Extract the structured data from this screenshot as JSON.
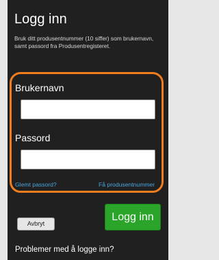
{
  "header": {
    "title": "Logg inn",
    "description": "Bruk ditt produsentnummer (10 siffer) som brukernavn, samt passord fra Produsentregisteret."
  },
  "form": {
    "username_label": "Brukernavn",
    "username_value": "",
    "password_label": "Passord",
    "password_value": "",
    "forgot_password_link": "Glemt passord?",
    "get_producer_number_link": "Få produsentnummer"
  },
  "actions": {
    "cancel_label": "Avbryt",
    "login_label": "Logg inn"
  },
  "footer": {
    "problems_link": "Problemer med å logge inn?"
  },
  "colors": {
    "background": "#202020",
    "highlight": "#f07d1e",
    "link": "#4aa6dd",
    "primary_button": "#2aa52a"
  }
}
